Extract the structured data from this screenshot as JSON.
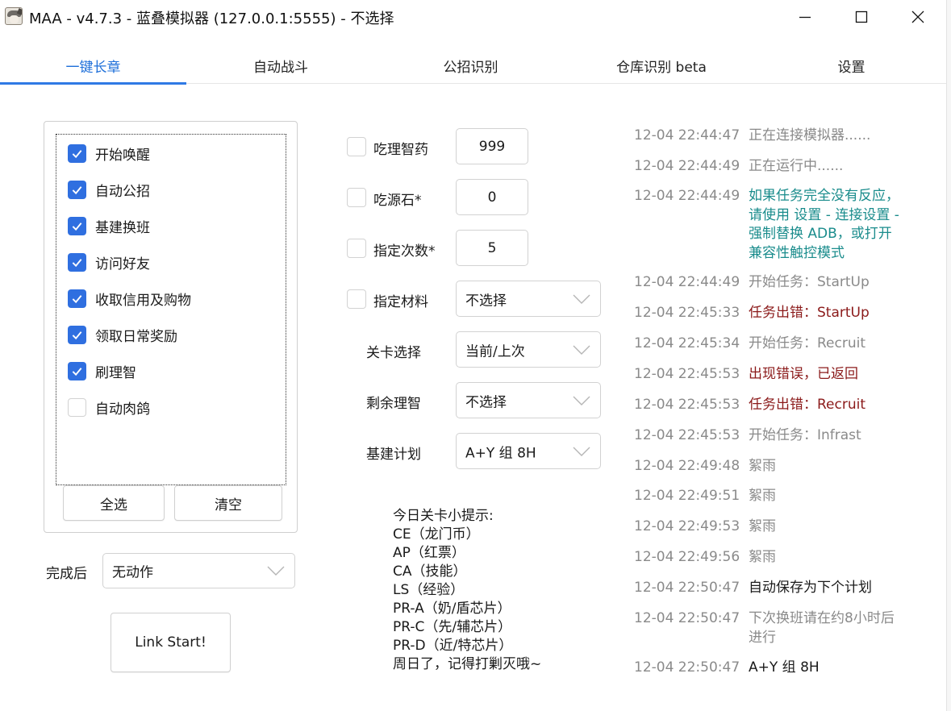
{
  "window": {
    "title": "MAA - v4.7.3 - 蓝叠模拟器 (127.0.0.1:5555) - 不选择",
    "icon": "maa-app-icon",
    "controls": [
      "minimize-icon",
      "maximize-icon",
      "close-icon"
    ]
  },
  "tabs": [
    {
      "label": "一键长章",
      "active": true
    },
    {
      "label": "自动战斗",
      "active": false
    },
    {
      "label": "公招识别",
      "active": false
    },
    {
      "label": "仓库识别 beta",
      "active": false
    },
    {
      "label": "设置",
      "active": false
    }
  ],
  "tasks": {
    "items": [
      {
        "label": "开始唤醒",
        "checked": true
      },
      {
        "label": "自动公招",
        "checked": true
      },
      {
        "label": "基建换班",
        "checked": true
      },
      {
        "label": "访问好友",
        "checked": true
      },
      {
        "label": "收取信用及购物",
        "checked": true
      },
      {
        "label": "领取日常奖励",
        "checked": true
      },
      {
        "label": "刷理智",
        "checked": true
      },
      {
        "label": "自动肉鸽",
        "checked": false
      }
    ],
    "select_all": "全选",
    "clear": "清空"
  },
  "after_finish": {
    "label": "完成后",
    "value": "无动作"
  },
  "link_start": "Link Start!",
  "options": {
    "medicine": {
      "label": "吃理智药",
      "value": "999",
      "checked": false
    },
    "stone": {
      "label": "吃源石*",
      "value": "0",
      "checked": false
    },
    "times": {
      "label": "指定次数*",
      "value": "5",
      "checked": false
    },
    "material": {
      "label": "指定材料",
      "value": "不选择",
      "checked": false
    },
    "stage": {
      "label": "关卡选择",
      "value": "当前/上次"
    },
    "remaining": {
      "label": "剩余理智",
      "value": "不选择"
    },
    "infra_plan": {
      "label": "基建计划",
      "value": "A+Y 组 8H"
    }
  },
  "tips": [
    "今日关卡小提示:",
    "CE（龙门币）",
    "AP（红票）",
    "CA（技能）",
    "LS（经验）",
    "PR-A（奶/盾芯片）",
    "PR-C（先/辅芯片）",
    "PR-D（近/特芯片）",
    "周日了，记得打剿灭哦~"
  ],
  "log": [
    {
      "time": "12-04  22:44:47",
      "lines": [
        "正在连接模拟器......"
      ],
      "color": "#8a8a8a"
    },
    {
      "time": "12-04  22:44:49",
      "lines": [
        "正在运行中......"
      ],
      "color": "#8a8a8a"
    },
    {
      "time": "12-04  22:44:49",
      "lines": [
        "如果任务完全没有反应，",
        "请使用 设置 - 连接设置 -",
        "强制替换 ADB，或打开",
        "兼容性触控模式"
      ],
      "color": "#1a8c8c"
    },
    {
      "time": "12-04  22:44:49",
      "lines": [
        "开始任务：StartUp"
      ],
      "color": "#8a8a8a"
    },
    {
      "time": "12-04  22:45:33",
      "lines": [
        "任务出错：StartUp"
      ],
      "color": "#8b1a1a"
    },
    {
      "time": "12-04  22:45:34",
      "lines": [
        "开始任务：Recruit"
      ],
      "color": "#8a8a8a"
    },
    {
      "time": "12-04  22:45:53",
      "lines": [
        "出现错误，已返回"
      ],
      "color": "#8b1a1a"
    },
    {
      "time": "12-04  22:45:53",
      "lines": [
        "任务出错：Recruit"
      ],
      "color": "#8b1a1a"
    },
    {
      "time": "12-04  22:45:53",
      "lines": [
        "开始任务：Infrast"
      ],
      "color": "#8a8a8a"
    },
    {
      "time": "12-04  22:49:48",
      "lines": [
        "絮雨"
      ],
      "color": "#8a8a8a"
    },
    {
      "time": "12-04  22:49:51",
      "lines": [
        "絮雨"
      ],
      "color": "#8a8a8a"
    },
    {
      "time": "12-04  22:49:53",
      "lines": [
        "絮雨"
      ],
      "color": "#8a8a8a"
    },
    {
      "time": "12-04  22:49:56",
      "lines": [
        "絮雨"
      ],
      "color": "#8a8a8a"
    },
    {
      "time": "12-04  22:50:47",
      "lines": [
        "自动保存为下个计划"
      ],
      "color": "#1a1a1a"
    },
    {
      "time": "12-04  22:50:47",
      "lines": [
        "下次换班请在约8小时后",
        "进行"
      ],
      "color": "#8a8a8a"
    },
    {
      "time": "12-04  22:50:47",
      "lines": [
        "A+Y 组 8H"
      ],
      "color": "#1a1a1a"
    }
  ],
  "colors": {
    "accent": "#2f6fe0",
    "tab_active": "#1e6fd9",
    "log_error": "#8b1a1a",
    "log_info": "#1a8c8c"
  }
}
